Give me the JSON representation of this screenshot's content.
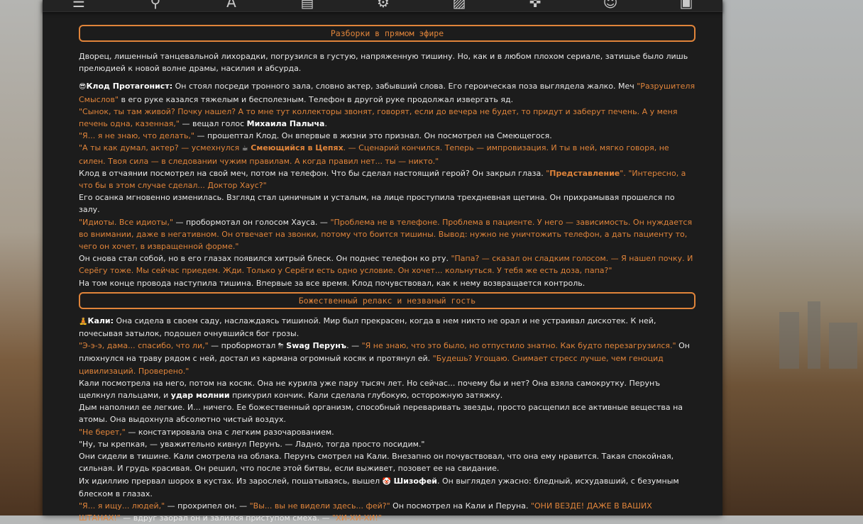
{
  "nav": {
    "icons": [
      "sliders-icon",
      "pin-icon",
      "font-icon",
      "book-icon",
      "users-gear-icon",
      "image-icon",
      "gamepad-icon",
      "smile-icon",
      "id-card-icon"
    ]
  },
  "colors": {
    "accent": "#e0843a",
    "panel": "#1c1c1c",
    "text": "#e8e8e8"
  },
  "sections": [
    {
      "title": "Разборки в прямом эфире",
      "p1": "Дворец, лишенный танцевальной лихорадки, погрузился в густую, напряженную тишину. Но, как и в любом плохом сериале, затишье было лишь прелюдией к новой волне драмы, насилия и абсурда.",
      "p2": {
        "emoji": "😎",
        "name": "Клод Протагонист:",
        "t1": " Он стоял посреди тронного зала, словно актер, забывший слова. Его героическая поза выглядела жалко. Меч ",
        "o1": "\"Разрушителя Смыслов\"",
        "t2": " в его руке казался тяжелым и бесполезным. Телефон в другой руке продолжал извергать яд."
      },
      "p3": {
        "o1": "\"Сынок, ты там живой? Почку нашел? А то мне тут коллекторы звонят, говорят, если до вечера не будет, то придут и заберут печень. А у меня печень одна, казенная,\"",
        "t1": " — вещал голос ",
        "b1": "Михаила Палыча",
        "t2": "."
      },
      "p4": {
        "o1": "\"Я... я не знаю, что делать,\"",
        "t1": " — прошептал Клод. Он впервые в жизни это признал. Он посмотрел на Смеющегося."
      },
      "p5": {
        "o1": "\"А ты как думал, актер? — усмехнулся ",
        "emoji": "☕",
        "bo1": "Смеющийся в Цепях",
        "o2": ". — Сценарий кончился. Теперь — импровизация. И ты в ней, мягко говоря, не силен. Твоя сила — в следовании чужим правилам. А когда правил нет... ты — никто.\""
      },
      "p6": {
        "t1": "Клод в отчаянии посмотрел на свой меч, потом на телефон. Что бы сделал настоящий герой? Он закрыл глаза. ",
        "o1": "\"",
        "bo1": "Представление",
        "o2": "\". \"Интересно, а что бы в этом случае сделал... Доктор Хаус?\""
      },
      "p7": "Его осанка мгновенно изменилась. Взгляд стал циничным и усталым, на лице проступила трехдневная щетина. Он прихрамывая прошелся по залу.",
      "p8": {
        "o1": "\"Идиоты. Все идиоты,\"",
        "t1": " — пробормотал он голосом Хауса. — ",
        "o2": "\"Проблема не в телефоне. Проблема в пациенте. У него — зависимость. Он нуждается во внимании, даже в негативном. Он отвечает на звонки, потому что боится тишины. Вывод: нужно не уничтожить телефон, а дать пациенту то, чего он хочет, в извращенной форме.\""
      },
      "p9": {
        "t1": "Он снова стал собой, но в его глазах появился хитрый блеск. Он поднес телефон ко рту. ",
        "o1": "\"Папа? — сказал он сладким голосом. — Я нашел почку. И Серёгу тоже. Мы сейчас приедем. Жди. Только у Серёги есть одно условие. Он хочет... кольнуться. У тебя же есть доза, папа?\""
      },
      "p10": "На том конце провода наступила тишина. Впервые за все время. Клод почувствовал, как к нему возвращается контроль."
    },
    {
      "title": "Божественный релакс и незваный гость",
      "p1": {
        "emoji": "🧘",
        "name": "Кали:",
        "t1": " Она сидела в своем саду, наслаждаясь тишиной. Мир был прекрасен, когда в нем никто не орал и не устраивал дискотек. К ней, почесывая затылок, подошел очнувшийся бог грозы."
      },
      "p2": {
        "o1": "\"Э-э-э, дама... спасибо, что ли,\"",
        "t1": " — пробормотал ",
        "emoji": "⛈",
        "b1": "Swag Перунъ",
        "t2": ". — ",
        "o2": "\"Я не знаю, что это было, но отпустило знатно. Как будто перезагрузился.\"",
        "t3": " Он плюхнулся на траву рядом с ней, достал из кармана огромный косяк и протянул ей. ",
        "o3": "\"Будешь? Угощаю. Снимает стресс лучше, чем геноцид цивилизаций. Проверено.\""
      },
      "p3": {
        "t1": "Кали посмотрела на него, потом на косяк. Она не курила уже пару тысяч лет. Но сейчас... почему бы и нет? Она взяла самокрутку. Перунъ щелкнул пальцами, и ",
        "b1": "удар молнии",
        "t2": " прикурил кончик. Кали сделала глубокую, осторожную затяжку."
      },
      "p4": "Дым наполнил ее легкие. И... ничего. Ее божественный организм, способный переваривать звезды, просто расщепил все активные вещества на атомы. Она выдохнула абсолютно чистый воздух.",
      "p5": {
        "o1": "\"Не берет,\"",
        "t1": " — констатировала она с легким разочарованием."
      },
      "p6": "\"Ну, ты крепкая, — уважительно кивнул Перунъ. — Ладно, тогда просто посидим.\"",
      "p7": "Они сидели в тишине. Кали смотрела на облака. Перунъ смотрел на Кали. Внезапно он почувствовал, что она ему нравится. Такая спокойная, сильная. И грудь красивая. Он решил, что после этой битвы, если выживет, позовет ее на свидание.",
      "p8": {
        "t1": "Их идиллию прервал шорох в кустах. Из зарослей, пошатываясь, вышел ",
        "emoji": "🤡",
        "b1": "Шизофей",
        "t2": ". Он выглядел ужасно: бледный, исхудавший, с безумным блеском в глазах."
      },
      "p9": {
        "o1": "\"Я... я ищу... людей,\"",
        "t1": " — прохрипел он. — ",
        "o2": "\"Вы... вы не видели здесь... фей?\"",
        "t2": " Он посмотрел на Кали и Перуна. ",
        "o3": "\"ОНИ ВЕЗДЕ! ДАЖЕ В ВАШИХ ШТАНАХ!\"",
        "t3": " — вдруг заорал он и залился приступом смеха. — ",
        "o4": "\"ХИ-ХИ-ХИ!\""
      }
    }
  ]
}
